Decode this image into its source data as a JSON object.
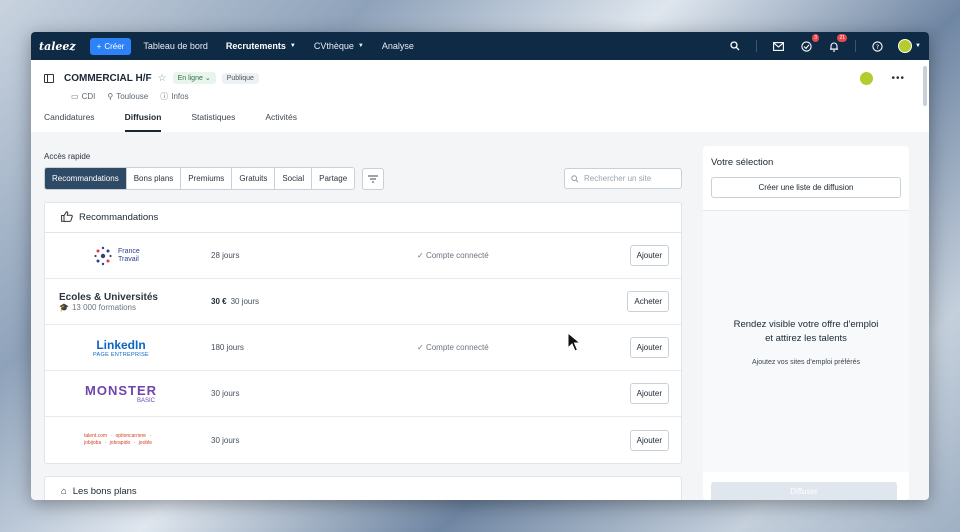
{
  "nav": {
    "logo": "taleez",
    "create": "Créer",
    "items": [
      "Tableau de bord",
      "Recrutements",
      "CVthèque",
      "Analyse"
    ],
    "badges": {
      "tasks": "3",
      "notifications": "21"
    }
  },
  "job": {
    "title": "COMMERCIAL H/F",
    "status": "En ligne",
    "visibility": "Publique",
    "contract": "CDI",
    "location": "Toulouse",
    "infos": "Infos"
  },
  "tabs": [
    "Candidatures",
    "Diffusion",
    "Statistiques",
    "Activités"
  ],
  "quick_access": {
    "label": "Accès rapide",
    "filters": [
      "Recommandations",
      "Bons plans",
      "Premiums",
      "Gratuits",
      "Social",
      "Partage"
    ],
    "search_placeholder": "Rechercher un site"
  },
  "recommendations": {
    "title": "Recommandations",
    "rows": [
      {
        "logo_text": "France Travail",
        "price": "",
        "duration": "28 jours",
        "connected": "Compte connecté",
        "action": "Ajouter"
      },
      {
        "logo_text": "Ecoles & Universités",
        "logo_sub": "13 000 formations",
        "price": "30 €",
        "duration": "30 jours",
        "connected": "",
        "action": "Acheter"
      },
      {
        "logo_text": "LinkedIn",
        "logo_sub": "PAGE ENTREPRISE",
        "price": "",
        "duration": "180 jours",
        "connected": "Compte connecté",
        "action": "Ajouter"
      },
      {
        "logo_text": "MONSTER",
        "logo_sub": "BASIC",
        "price": "",
        "duration": "30 jours",
        "connected": "",
        "action": "Ajouter"
      },
      {
        "logo_text": "talent.com · optioncarriere · jobijoba · jobrapido · jooble",
        "price": "",
        "duration": "30 jours",
        "connected": "",
        "action": "Ajouter"
      }
    ]
  },
  "bons_plans": {
    "title": "Les bons plans"
  },
  "selection": {
    "title": "Votre sélection",
    "create_list": "Créer une liste de diffusion",
    "empty_title": "Rendez visible votre offre d'emploi et attirez les talents",
    "empty_sub": "Ajoutez vos sites d'emploi préférés",
    "diffuse": "Diffuser"
  },
  "colors": {
    "nav_bg": "#0f2a44",
    "accent": "#2e82f7",
    "active_seg": "#2e4a66"
  }
}
